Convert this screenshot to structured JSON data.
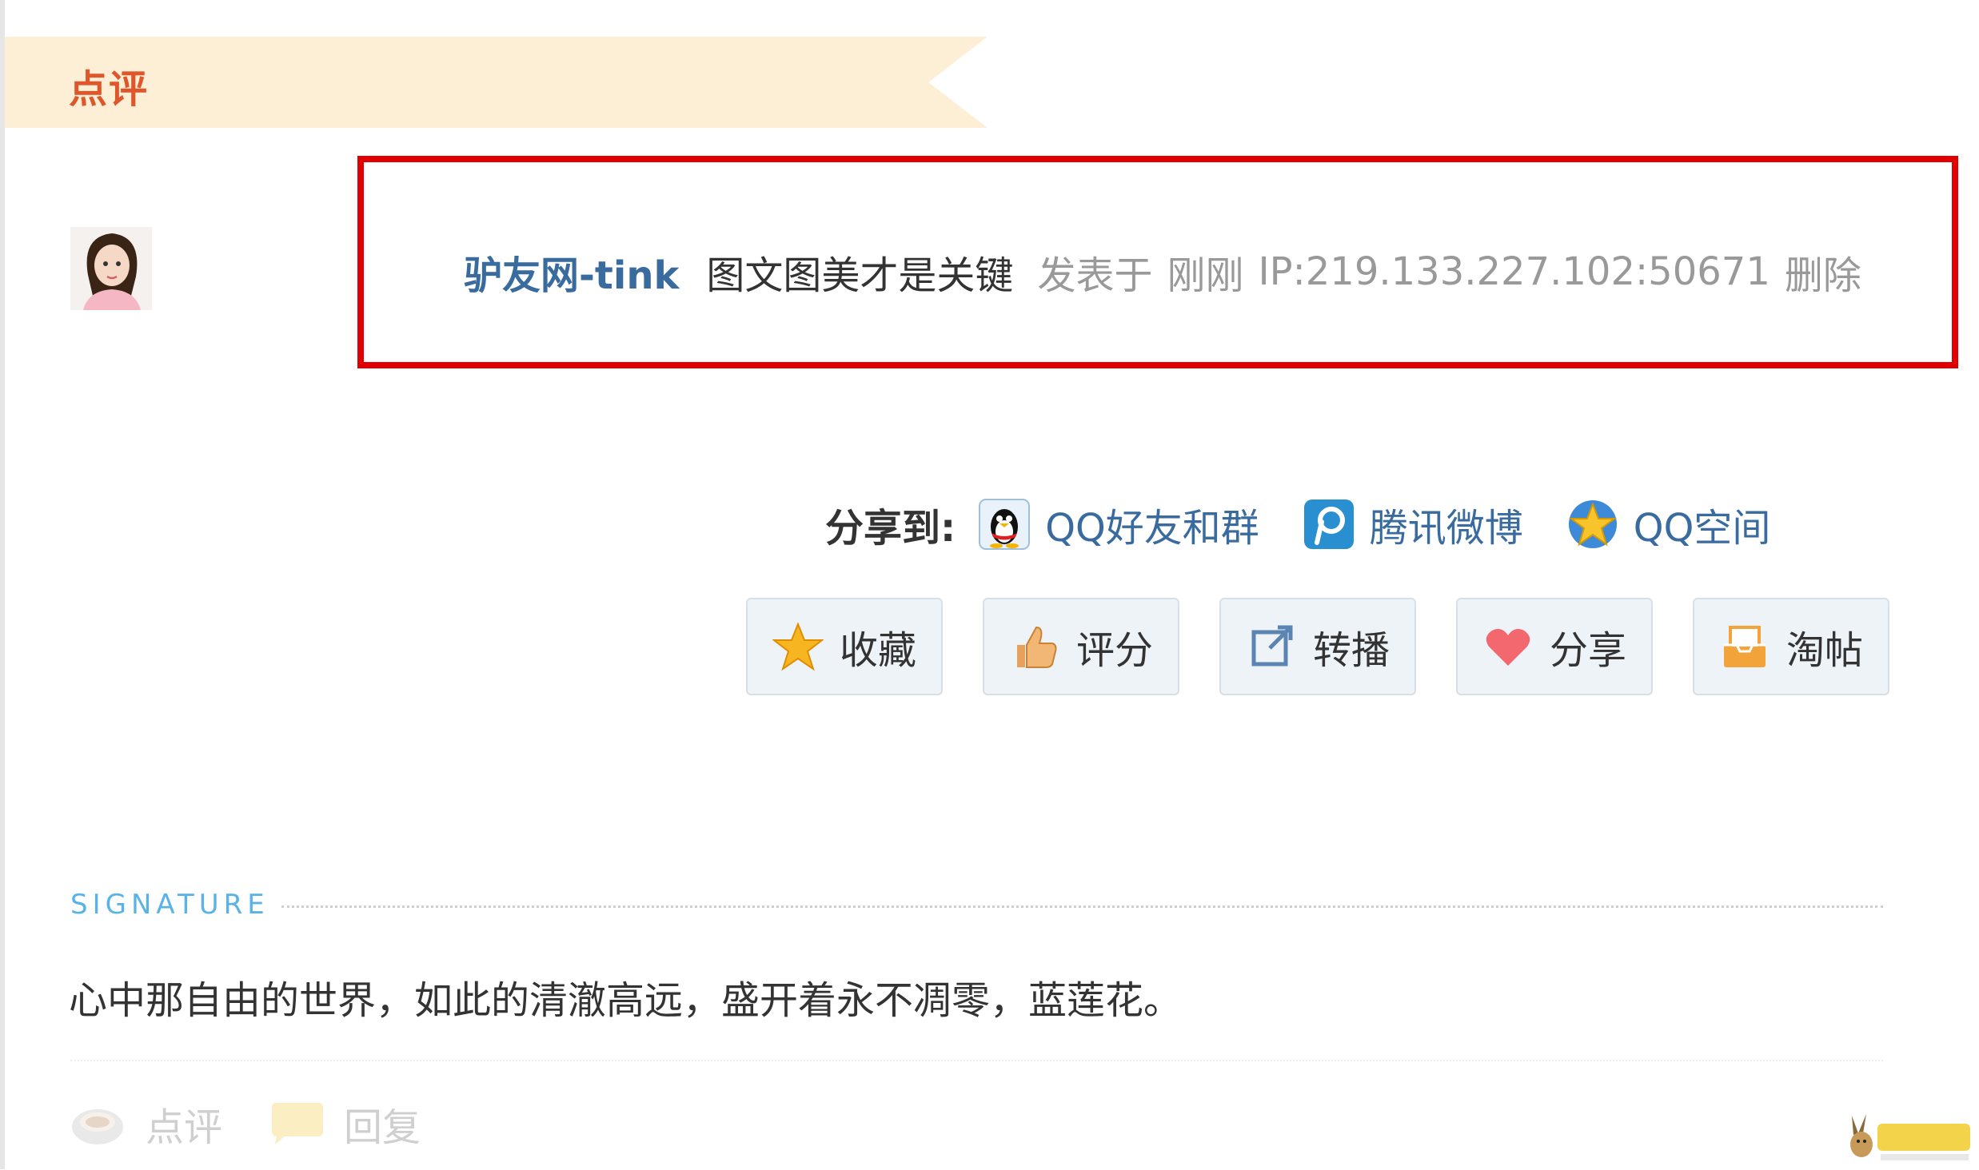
{
  "header": {
    "title": "点评"
  },
  "comment": {
    "user": "驴友网-tink",
    "text": "图文图美才是关键",
    "posted_prefix": "发表于",
    "time": "刚刚",
    "ip": "IP:219.133.227.102:50671",
    "delete_label": "删除"
  },
  "share": {
    "label": "分享到:",
    "items": [
      {
        "label": "QQ好友和群",
        "icon": "qq-penguin-icon"
      },
      {
        "label": "腾讯微博",
        "icon": "tencent-weibo-icon"
      },
      {
        "label": "QQ空间",
        "icon": "qzone-star-icon"
      }
    ]
  },
  "actions": [
    {
      "label": "收藏",
      "icon": "star-icon"
    },
    {
      "label": "评分",
      "icon": "thumbs-up-icon"
    },
    {
      "label": "转播",
      "icon": "repost-icon"
    },
    {
      "label": "分享",
      "icon": "heart-icon"
    },
    {
      "label": "淘帖",
      "icon": "tray-icon"
    }
  ],
  "signature": {
    "label": "SIGNATURE",
    "text": "心中那自由的世界，如此的清澈高远，盛开着永不凋零，蓝莲花。"
  },
  "footer": {
    "comment_label": "点评",
    "reply_label": "回复"
  },
  "colors": {
    "accent_red": "#e00000",
    "link_blue": "#3a6b9e",
    "ribbon_bg": "#fcefd6",
    "ribbon_text": "#e0562b",
    "signature_blue": "#5ab3e6"
  }
}
